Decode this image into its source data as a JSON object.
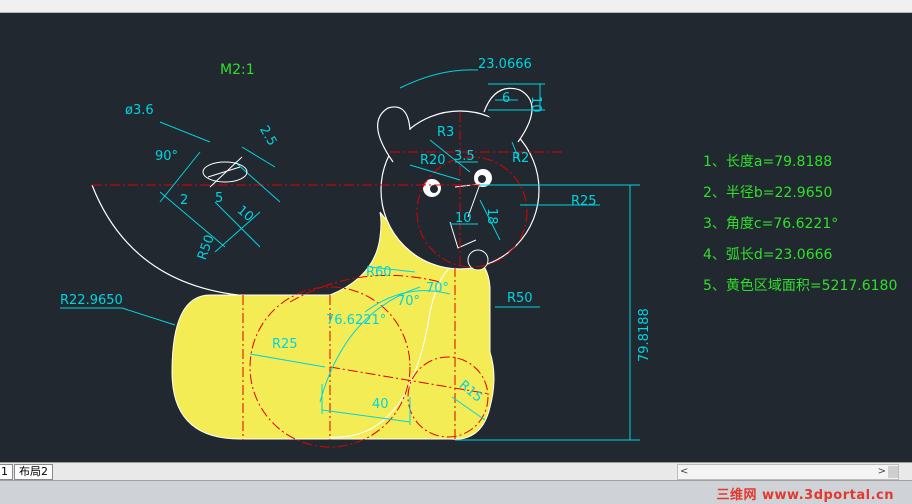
{
  "colors": {
    "background": "#212830",
    "dimension": "#00d4e0",
    "centerline": "#e00000",
    "fill": "#f3ec55",
    "outline": "#ffffff",
    "note_text": "#2fe02a"
  },
  "drawing": {
    "scale_label": "M2:1",
    "dims": {
      "hole_diameter": "ø3.6",
      "angle_90": "90°",
      "d_2_5": "2.5",
      "d_2": "2",
      "d_5": "5",
      "d_10_left": "10",
      "r50_left": "R50",
      "r22_9650": "R22.9650",
      "arc_23_0666": "23.0666",
      "d_6": "6",
      "d_10_top": "10",
      "r3": "R3",
      "r2": "R2",
      "r20": "R20",
      "d_3_5": "3.5",
      "d_10_mid": "10",
      "d_18": "18",
      "r25_right": "R25",
      "r60": "R60",
      "a70_left": "70°",
      "a70_right": "70°",
      "r50_right": "R50",
      "angle_76_6221": "76.6221°",
      "r25_body": "R25",
      "d_40": "40",
      "r15": "R15",
      "d_79_8188": "79.8188"
    }
  },
  "notes": [
    "1、长度a=79.8188",
    "2、半径b=22.9650",
    "3、角度c=76.6221°",
    "4、弧长d=23.0666",
    "5、黄色区域面积=5217.6180"
  ],
  "tabs": [
    "1",
    "布局2"
  ],
  "watermark": "三维网 www.3dportal.cn"
}
